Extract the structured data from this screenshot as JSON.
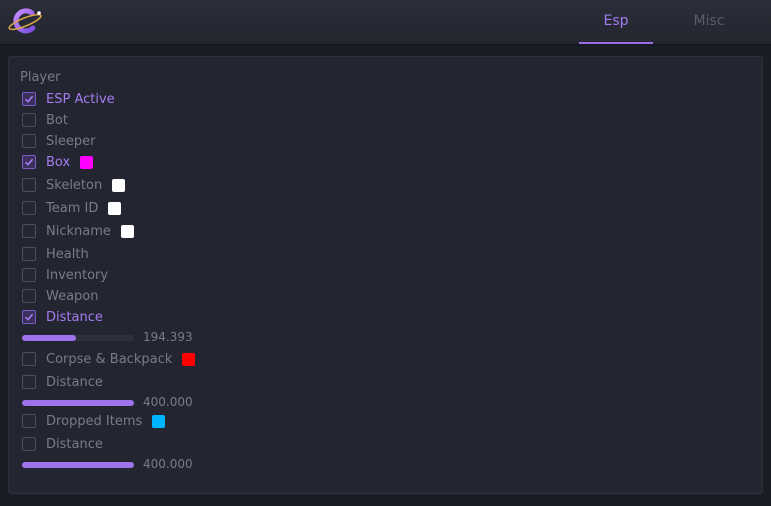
{
  "header": {
    "logo_icon": "planet-ring-icon",
    "tabs": [
      {
        "label": "Esp",
        "active": true
      },
      {
        "label": "Misc",
        "active": false
      }
    ]
  },
  "colors": {
    "accent": "#9d72eb",
    "accent_text": "#a57cf0",
    "muted_text": "#767c88",
    "panel_bg": "#232631"
  },
  "player": {
    "section_title": "Player",
    "esp_active": {
      "label": "ESP Active",
      "checked": true
    },
    "bot": {
      "label": "Bot",
      "checked": false
    },
    "sleeper": {
      "label": "Sleeper",
      "checked": false
    },
    "box": {
      "label": "Box",
      "checked": true,
      "color": "#ff00ff"
    },
    "skeleton": {
      "label": "Skeleton",
      "checked": false,
      "color": "#ffffff"
    },
    "team_id": {
      "label": "Team ID",
      "checked": false,
      "color": "#ffffff"
    },
    "nickname": {
      "label": "Nickname",
      "checked": false,
      "color": "#ffffff"
    },
    "health": {
      "label": "Health",
      "checked": false
    },
    "inventory": {
      "label": "Inventory",
      "checked": false
    },
    "weapon": {
      "label": "Weapon",
      "checked": false
    },
    "distance": {
      "label": "Distance",
      "checked": true
    },
    "distance_slider": {
      "value": "194.393",
      "fraction": 0.485
    }
  },
  "corpse": {
    "label": "Corpse & Backpack",
    "checked": false,
    "color": "#ff0000",
    "distance": {
      "label": "Distance",
      "checked": false
    },
    "distance_slider": {
      "value": "400.000",
      "fraction": 1.0
    }
  },
  "dropped": {
    "label": "Dropped Items",
    "checked": false,
    "color": "#00b4ff",
    "distance": {
      "label": "Distance",
      "checked": false
    },
    "distance_slider": {
      "value": "400.000",
      "fraction": 1.0
    }
  }
}
